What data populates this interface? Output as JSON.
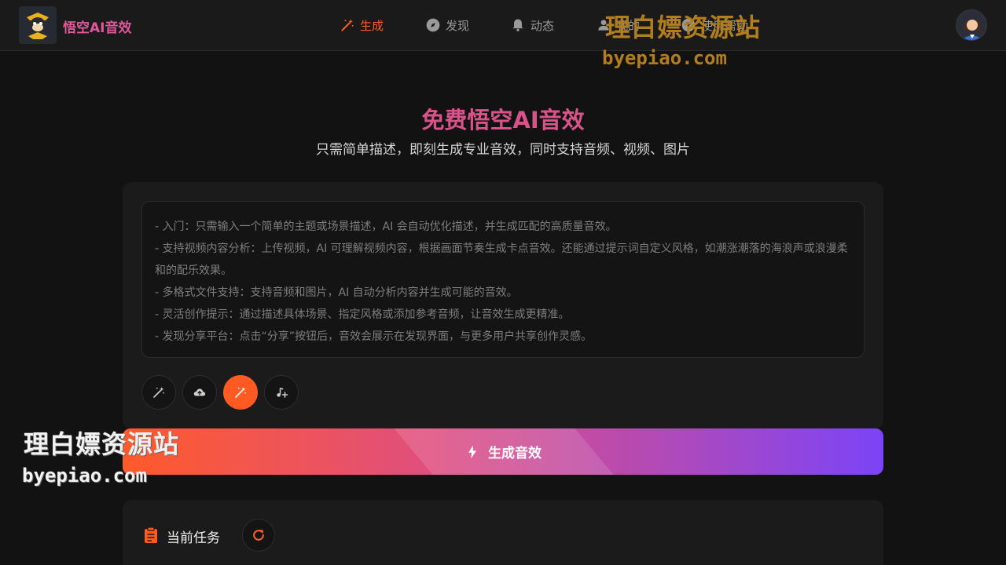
{
  "header": {
    "brand": "悟空AI音效",
    "nav": [
      {
        "label": "生成",
        "icon": "magic-wand-icon",
        "active": true
      },
      {
        "label": "发现",
        "icon": "compass-icon",
        "active": false
      },
      {
        "label": "动态",
        "icon": "bell-icon",
        "active": false
      },
      {
        "label": "我的",
        "icon": "user-icon",
        "active": false
      },
      {
        "label": "使用帮助",
        "icon": "help-icon",
        "active": false
      }
    ]
  },
  "watermark": {
    "text": "理白嫖资源站",
    "url": "byepiao.com"
  },
  "hero": {
    "title": "免费悟空AI音效",
    "subtitle": "只需简单描述，即刻生成专业音效，同时支持音频、视频、图片"
  },
  "prompt": {
    "placeholder_lines": [
      "- 入门：只需输入一个简单的主题或场景描述，AI 会自动优化描述，并生成匹配的高质量音效。",
      "- 支持视频内容分析：上传视频，AI 可理解视频内容，根据画面节奏生成卡点音效。还能通过提示词自定义风格，如潮涨潮落的海浪声或浪漫柔和的配乐效果。",
      "- 多格式文件支持：支持音频和图片，AI 自动分析内容并生成可能的音效。",
      "- 灵活创作提示：通过描述具体场景、指定风格或添加参考音频，让音效生成更精准。",
      "- 发现分享平台：点击“分享”按钮后，音效会展示在发现界面，与更多用户共享创作灵感。"
    ]
  },
  "tools": [
    {
      "icon": "magic-wand-icon",
      "active": false
    },
    {
      "icon": "cloud-upload-icon",
      "active": false
    },
    {
      "icon": "magic-wand-icon",
      "active": true
    },
    {
      "icon": "music-add-icon",
      "active": false
    }
  ],
  "generate_button": {
    "label": "生成音效",
    "icon": "lightning-icon"
  },
  "task": {
    "title": "当前任务",
    "icon": "clipboard-icon"
  },
  "colors": {
    "accent": "#ff5a22",
    "brand_pink": "#e0589a",
    "gradient_end": "#7b44f7",
    "background": "#121212"
  }
}
